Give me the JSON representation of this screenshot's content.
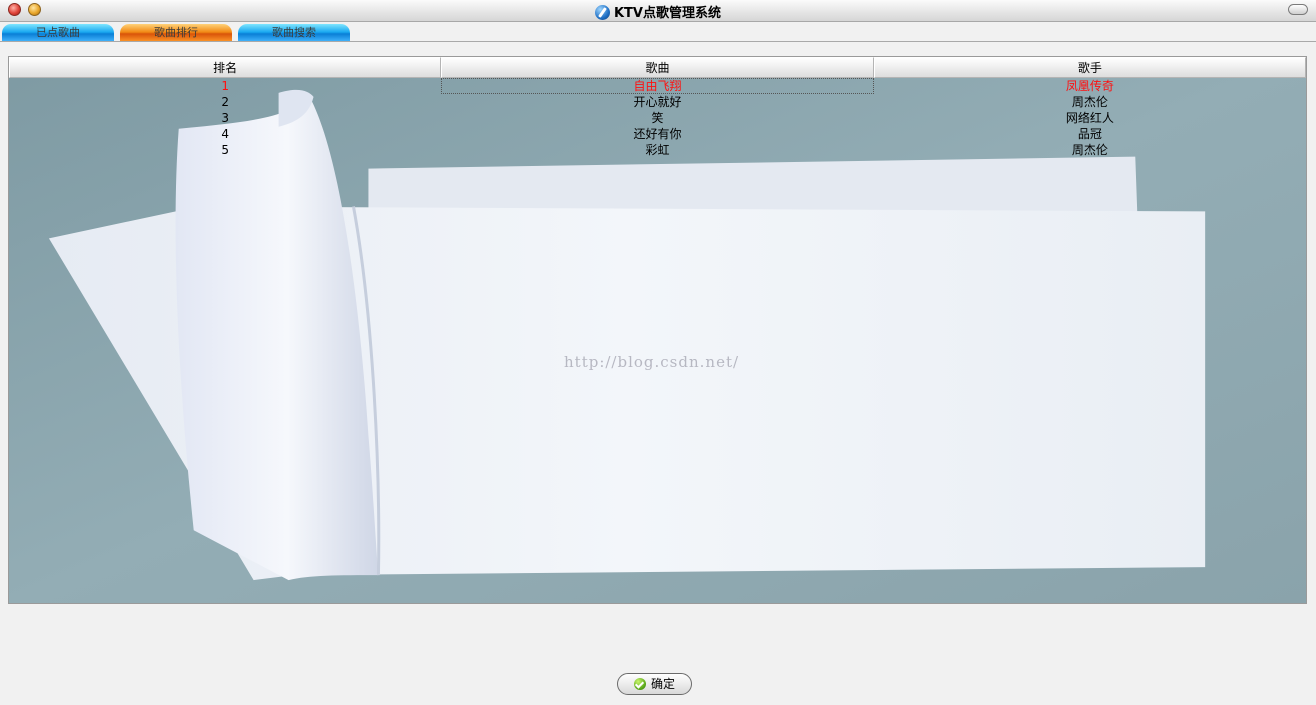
{
  "window": {
    "title": "KTV点歌管理系统"
  },
  "tabs": [
    {
      "label": "已点歌曲",
      "color": "blue"
    },
    {
      "label": "歌曲排行",
      "color": "orange",
      "selected": true
    },
    {
      "label": "歌曲搜索",
      "color": "blue"
    }
  ],
  "table": {
    "columns": [
      "排名",
      "歌曲",
      "歌手"
    ],
    "rows": [
      {
        "rank": "1",
        "song": "自由飞翔",
        "singer": "凤凰传奇"
      },
      {
        "rank": "2",
        "song": "开心就好",
        "singer": "周杰伦"
      },
      {
        "rank": "3",
        "song": "笑",
        "singer": "网络红人"
      },
      {
        "rank": "4",
        "song": "还好有你",
        "singer": "品冠"
      },
      {
        "rank": "5",
        "song": "彩虹",
        "singer": "周杰伦"
      }
    ],
    "selected_row": 0
  },
  "watermark": "http://blog.csdn.net/",
  "confirm_button": {
    "label": "确定"
  },
  "colors": {
    "selected_text": "#ff1010",
    "tab_blue": "#1aa8f0",
    "tab_orange": "#f28a14",
    "panel_bg": "#8aa3ab"
  }
}
